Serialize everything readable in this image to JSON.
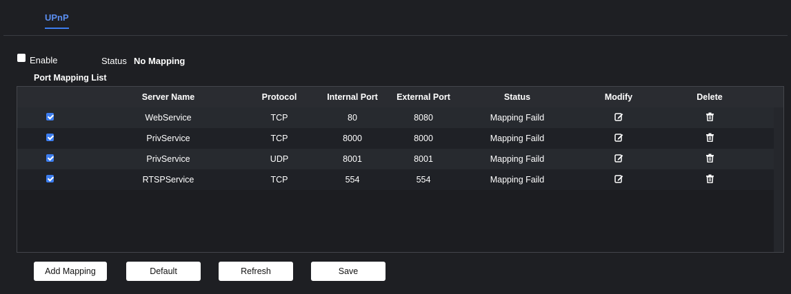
{
  "tabs": [
    {
      "label": "UPnP",
      "active": true
    }
  ],
  "enable": {
    "label": "Enable",
    "checked": false
  },
  "status": {
    "label": "Status",
    "value": "No Mapping"
  },
  "port_mapping_list": {
    "title": "Port Mapping List",
    "columns": [
      "",
      "Server Name",
      "Protocol",
      "Internal Port",
      "External Port",
      "Status",
      "Modify",
      "Delete"
    ],
    "rows": [
      {
        "checked": true,
        "server_name": "WebService",
        "protocol": "TCP",
        "internal_port": "80",
        "external_port": "8080",
        "status": "Mapping Faild"
      },
      {
        "checked": true,
        "server_name": "PrivService",
        "protocol": "TCP",
        "internal_port": "8000",
        "external_port": "8000",
        "status": "Mapping Faild"
      },
      {
        "checked": true,
        "server_name": "PrivService",
        "protocol": "UDP",
        "internal_port": "8001",
        "external_port": "8001",
        "status": "Mapping Faild"
      },
      {
        "checked": true,
        "server_name": "RTSPService",
        "protocol": "TCP",
        "internal_port": "554",
        "external_port": "554",
        "status": "Mapping Faild"
      }
    ]
  },
  "buttons": {
    "add_mapping": "Add Mapping",
    "default": "Default",
    "refresh": "Refresh",
    "save": "Save"
  },
  "icons": {
    "modify": "edit-icon",
    "delete": "trash-icon"
  },
  "colors": {
    "background": "#1e1f23",
    "accent": "#3d7ef0",
    "tab_text": "#5b8ef0"
  }
}
